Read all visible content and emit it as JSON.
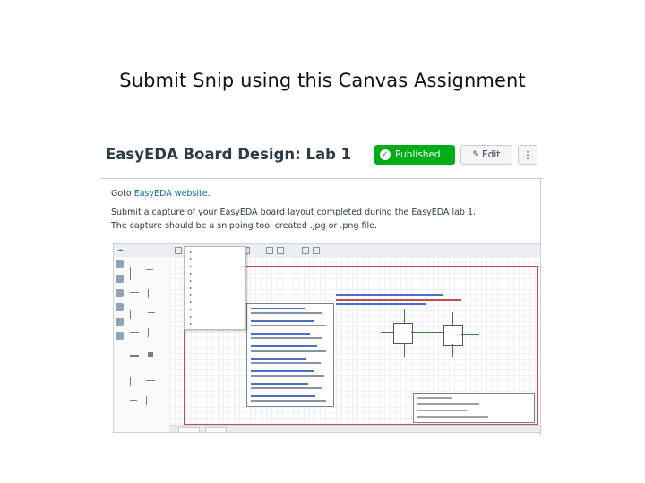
{
  "slide": {
    "title": "Submit Snip using this Canvas Assignment"
  },
  "canvas": {
    "page_title": "EasyEDA Board Design: Lab 1",
    "published_label": "Published",
    "edit_label": "Edit",
    "more_label": "⋮",
    "instructions": {
      "line1_prefix": "Goto ",
      "line1_link": "EasyEDA website",
      "line1_suffix": ".",
      "line2": "Submit a capture of your EasyEDA board layout completed during the EasyEDA lab 1.",
      "line3": "The capture should be a snipping tool created .jpg or .png file."
    }
  },
  "colors": {
    "published_green": "#00ac18",
    "link_blue": "#0770a3",
    "text_dark": "#2d3b45",
    "schematic_frame": "#c44c4c"
  },
  "icons": {
    "published": "check-circle-icon",
    "edit": "pencil-icon",
    "more": "vertical-ellipsis-icon"
  }
}
